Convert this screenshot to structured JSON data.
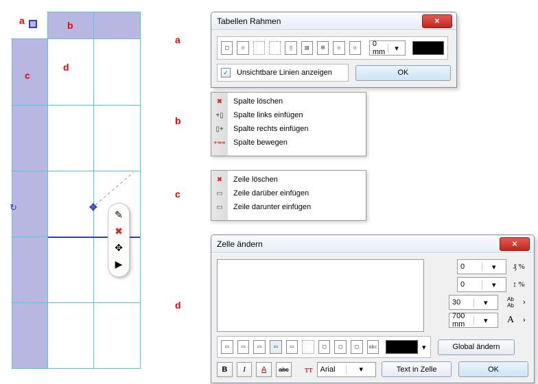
{
  "labels": {
    "a": "a",
    "b": "b",
    "c": "c",
    "d": "d"
  },
  "leftTable": {
    "a": "a",
    "b": "b",
    "c": "c",
    "d": "d"
  },
  "dialogA": {
    "title": "Tabellen Rahmen",
    "width": "0 mm",
    "checkbox": "Unsichtbare Linien anzeigen",
    "ok": "OK"
  },
  "ctxB": {
    "items": [
      {
        "icon": "✖",
        "iconColor": "#d22",
        "label": "Spalte löschen"
      },
      {
        "icon": "+▯",
        "iconColor": "#333",
        "label": "Spalte links einfügen"
      },
      {
        "icon": "▯+",
        "iconColor": "#333",
        "label": "Spalte rechts einfügen"
      },
      {
        "icon": "↤↦",
        "iconColor": "#d22",
        "label": "Spalte bewegen"
      }
    ]
  },
  "ctxC": {
    "items": [
      {
        "icon": "✖",
        "iconColor": "#d22",
        "label": "Zeile löschen"
      },
      {
        "icon": "▭",
        "iconColor": "#555",
        "label": "Zeile darüber einfügen"
      },
      {
        "icon": "▭",
        "iconColor": "#555",
        "label": "Zeile darunter einfügen"
      }
    ]
  },
  "dialogD": {
    "title": "Zelle ändern",
    "spin1": "0",
    "unit1": "₰ %",
    "spin2": "0",
    "unit2": "↕ %",
    "spin3": "30",
    "spin4": "700 mm",
    "unit4": "A",
    "globalBtn": "Global ändern",
    "textBtn": "Text in Zelle",
    "ok": "OK",
    "font": "Arial",
    "abc": "abc"
  }
}
